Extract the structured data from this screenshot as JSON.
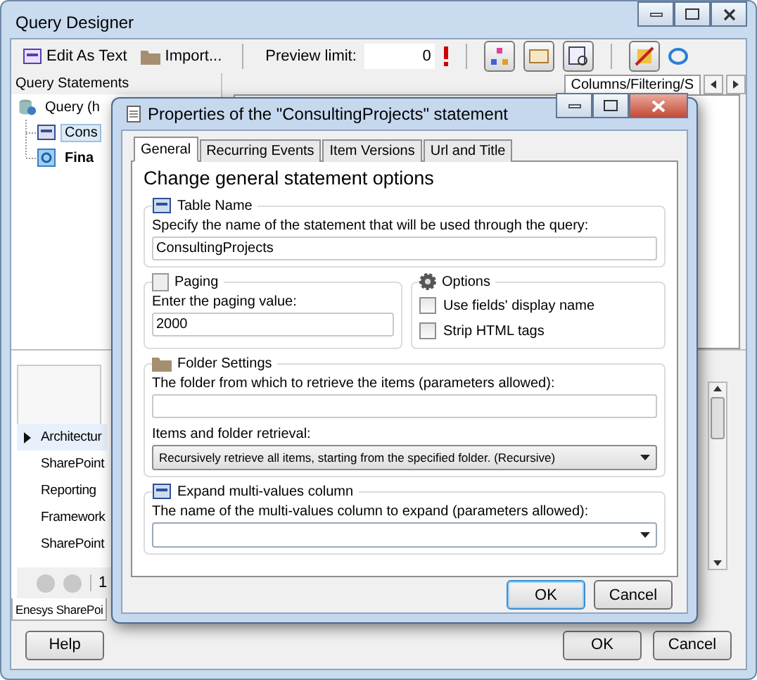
{
  "window": {
    "title": "Query Designer"
  },
  "toolbar": {
    "edit_as_text": "Edit As Text",
    "import": "Import...",
    "preview_limit_label": "Preview limit:",
    "preview_limit_value": "0"
  },
  "query_statements": {
    "title": "Query Statements",
    "tree": [
      {
        "label": "Query (h",
        "kind": "query",
        "expanded": true,
        "children": [
          {
            "label": "Cons",
            "kind": "table",
            "selected": true
          },
          {
            "label": "Fina",
            "kind": "final",
            "selected": false
          }
        ]
      }
    ]
  },
  "right_tabs": [
    {
      "label": "Columns/Filtering/S",
      "selected": true
    }
  ],
  "grid": {
    "rows": [
      {
        "label": "Architectur",
        "selected": true
      },
      {
        "label": "SharePoint",
        "selected": false
      },
      {
        "label": "Reporting",
        "selected": false
      },
      {
        "label": "Framework",
        "selected": false
      },
      {
        "label": "SharePoint",
        "selected": false
      }
    ]
  },
  "pager": {
    "page": "1"
  },
  "bottom_tab": "Enesys SharePoi",
  "buttons": [
    {
      "label": "Help"
    },
    {
      "label": "OK"
    },
    {
      "label": "Cancel"
    }
  ],
  "dialog": {
    "title": "Properties of the \"ConsultingProjects\" statement",
    "tabs": [
      {
        "label": "General",
        "selected": true
      },
      {
        "label": "Recurring Events",
        "selected": false
      },
      {
        "label": "Item Versions",
        "selected": false
      },
      {
        "label": "Url and Title",
        "selected": false
      }
    ],
    "heading": "Change general statement options",
    "table_name": {
      "title": "Table Name",
      "label": "Specify the name of the statement that will be used through the query:",
      "value": "ConsultingProjects"
    },
    "paging": {
      "title": "Paging",
      "label": "Enter the paging value:",
      "value": "2000"
    },
    "options": {
      "title": "Options",
      "items": [
        {
          "label": "Use fields' display name",
          "checked": false
        },
        {
          "label": "Strip HTML tags",
          "checked": false
        }
      ]
    },
    "folder_settings": {
      "title": "Folder Settings",
      "label": "The folder from which to retrieve the items (parameters allowed):",
      "retrieval_label": "Items and folder retrieval:",
      "retrieval_value": "Recursively retrieve all items, starting from the specified folder. (Recursive)"
    },
    "expand": {
      "title": "Expand multi-values column",
      "label": "The name of the multi-values column to expand (parameters allowed):"
    },
    "buttons": [
      {
        "label": "OK",
        "focused": true
      },
      {
        "label": "Cancel",
        "focused": false
      }
    ]
  }
}
